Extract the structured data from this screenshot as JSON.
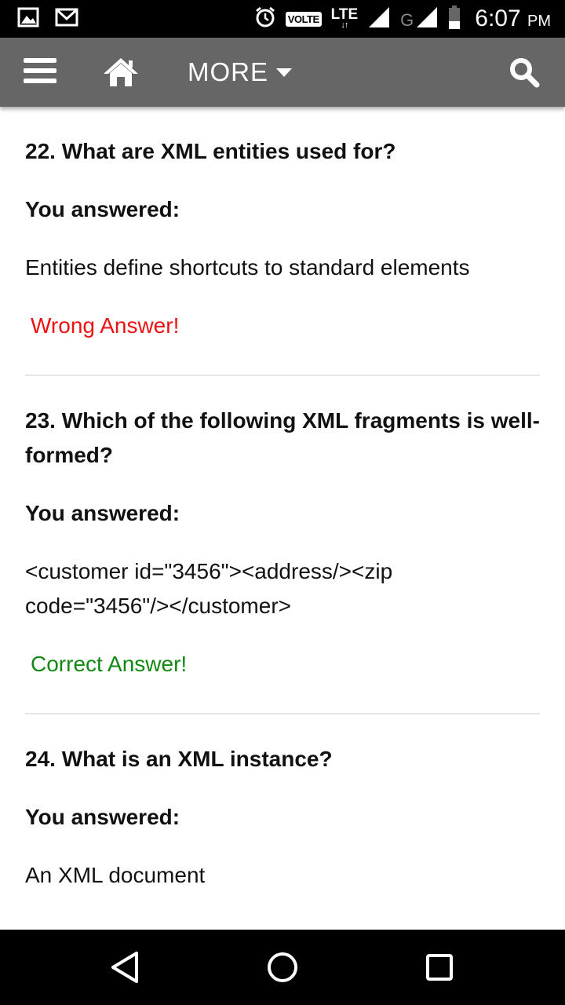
{
  "status_bar": {
    "volte": "VOLTE",
    "lte": "LTE",
    "network_g": "G",
    "time": "6:07",
    "ampm": "PM",
    "icons": [
      "image-icon",
      "gmail-icon",
      "alarm-icon",
      "signal-icon",
      "battery-icon"
    ]
  },
  "app_bar": {
    "background": "#666666",
    "more_label": "MORE",
    "icons": [
      "menu-icon",
      "home-icon",
      "caret-down-icon",
      "search-icon"
    ]
  },
  "questions": [
    {
      "question": "22. What are XML entities used for?",
      "you_answered_label": "You answered:",
      "answer": "Entities define shortcuts to standard elements",
      "verdict": "Wrong Answer!",
      "verdict_color": "#ee1111"
    },
    {
      "question": "23. Which of the following XML fragments is well-formed?",
      "you_answered_label": "You answered:",
      "answer": "<customer id=\"3456\"><address/><zip code=\"3456\"/></customer>",
      "verdict": "Correct Answer!",
      "verdict_color": "#118811"
    },
    {
      "question": "24. What is an XML instance?",
      "you_answered_label": "You answered:",
      "answer": "An XML document"
    }
  ],
  "nav_bar": {
    "icons": [
      "back-icon",
      "home-circle-icon",
      "recent-apps-icon"
    ]
  }
}
